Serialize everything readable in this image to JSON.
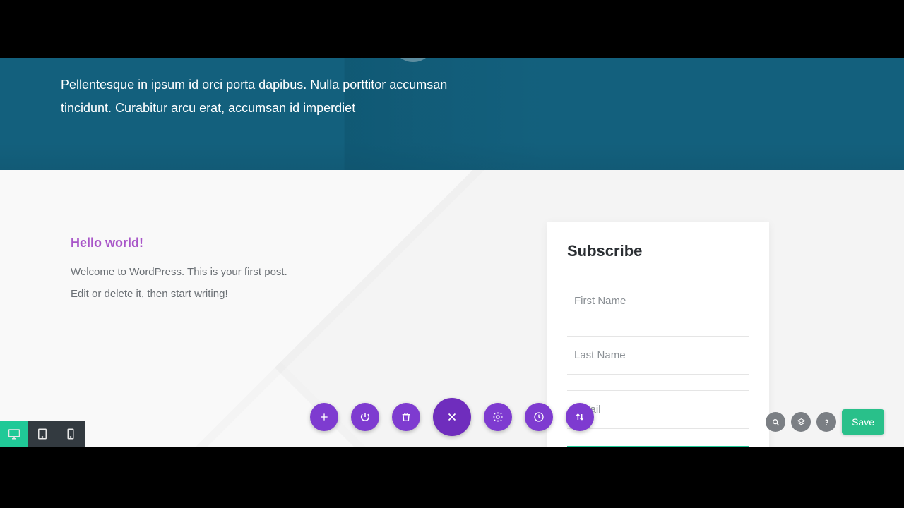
{
  "hero": {
    "paragraph": "Pellentesque in ipsum id orci porta dapibus. Nulla porttitor accumsan tincidunt. Curabitur arcu erat, accumsan id imperdiet"
  },
  "post": {
    "title": "Hello world!",
    "body": "Welcome to WordPress. This is your first post. Edit or delete it, then start writing!"
  },
  "subscribe": {
    "heading": "Subscribe",
    "first_name_placeholder": "First Name",
    "last_name_placeholder": "Last Name",
    "email_placeholder": "Email"
  },
  "toolbar": {
    "save_label": "Save"
  }
}
